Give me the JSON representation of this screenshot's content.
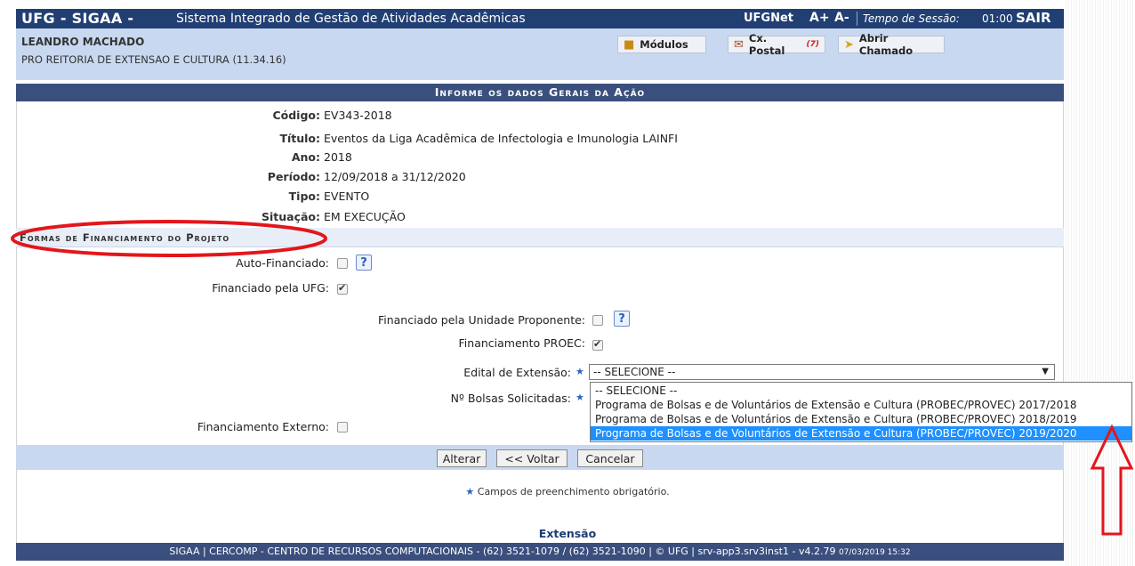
{
  "topbar": {
    "app": "UFG - SIGAA -",
    "system_name": "Sistema Integrado de Gestão de Atividades Acadêmicas",
    "ufgnet": "UFGNet",
    "font_increase": "A+",
    "font_decrease": "A-",
    "session_label": "Tempo de Sessão:",
    "session_value": "01:00",
    "logout": "SAIR"
  },
  "user": {
    "name": "LEANDRO MACHADO",
    "unit": "PRO REITORIA DE EXTENSAO E CULTURA (11.34.16)"
  },
  "toolbar": {
    "modules": "Módulos",
    "mailbox": "Cx. Postal",
    "mailbox_count": "(7)",
    "ticket": "Abrir Chamado"
  },
  "form": {
    "header": "Informe os dados Gerais da Ação",
    "fields": [
      {
        "label": "Código:",
        "value": "EV343-2018"
      },
      {
        "label": "Título:",
        "value": "Eventos da Liga Acadêmica de Infectologia e Imunologia LAINFI"
      },
      {
        "label": "Ano:",
        "value": "2018"
      },
      {
        "label": "Período:",
        "value": "12/09/2018 a 31/12/2020"
      },
      {
        "label": "Tipo:",
        "value": "EVENTO"
      },
      {
        "label": "Situação:",
        "value": "EM EXECUÇÃO"
      }
    ]
  },
  "financing": {
    "header": "Formas de Financiamento do Projeto",
    "self_funded": "Auto-Financiado:",
    "ufg_funded": "Financiado pela UFG:",
    "unit_funded": "Financiado pela Unidade Proponente:",
    "proec": "Financiamento PROEC:",
    "edital_label": "Edital de Extensão:",
    "bolsas_label": "Nº Bolsas Solicitadas:",
    "external": "Financiamento Externo:",
    "required_star": "★",
    "help": "?",
    "self_funded_checked": false,
    "ufg_funded_checked": true,
    "unit_funded_checked": false,
    "proec_checked": true,
    "external_checked": false,
    "select_value": "-- SELECIONE --",
    "select_arrow": "▼",
    "options": [
      "-- SELECIONE --",
      "Programa de Bolsas e de Voluntários de Extensão e Cultura (PROBEC/PROVEC) 2017/2018",
      "Programa de Bolsas e de Voluntários de Extensão e Cultura (PROBEC/PROVEC) 2018/2019",
      "Programa de Bolsas e de Voluntários de Extensão e Cultura (PROBEC/PROVEC) 2019/2020"
    ],
    "highlighted_option": 3
  },
  "buttons": {
    "alterar": "Alterar",
    "voltar": "<< Voltar",
    "cancelar": "Cancelar"
  },
  "note": "Campos de preenchimento obrigatório.",
  "footer": {
    "section": "Extensão",
    "text": "SIGAA | CERCOMP - CENTRO DE RECURSOS COMPUTACIONAIS - (62) 3521-1079 / (62) 3521-1090 | © UFG | srv-app3.srv3inst1 - v4.2.79",
    "timestamp": "07/03/2019 15:32"
  },
  "colors": {
    "topbar": "#223f73",
    "panel": "#c8d8f0",
    "highlight_option": "#1e90ff",
    "annotation": "#e3161b"
  }
}
